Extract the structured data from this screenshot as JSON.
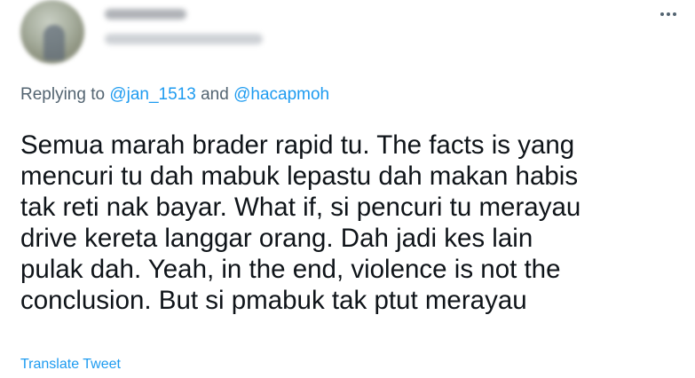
{
  "header": {
    "more_icon": "more-horizontal-icon"
  },
  "reply": {
    "prefix": "Replying to ",
    "mention_1": "@jan_1513",
    "conjunction": " and ",
    "mention_2": "@hacapmoh"
  },
  "tweet": {
    "lines": [
      "Semua marah brader rapid tu. The facts is yang",
      "mencuri tu dah mabuk lepastu dah makan habis",
      "tak reti nak bayar. What if, si pencuri tu merayau",
      "drive kereta langgar orang. Dah jadi kes lain",
      "pulak dah. Yeah, in the end, violence is not the",
      "conclusion. But si pmabuk tak ptut merayau"
    ]
  },
  "actions": {
    "translate_label": "Translate Tweet"
  },
  "colors": {
    "link": "#1d9bf0",
    "secondary_text": "#536471",
    "primary_text": "#0f1419"
  }
}
